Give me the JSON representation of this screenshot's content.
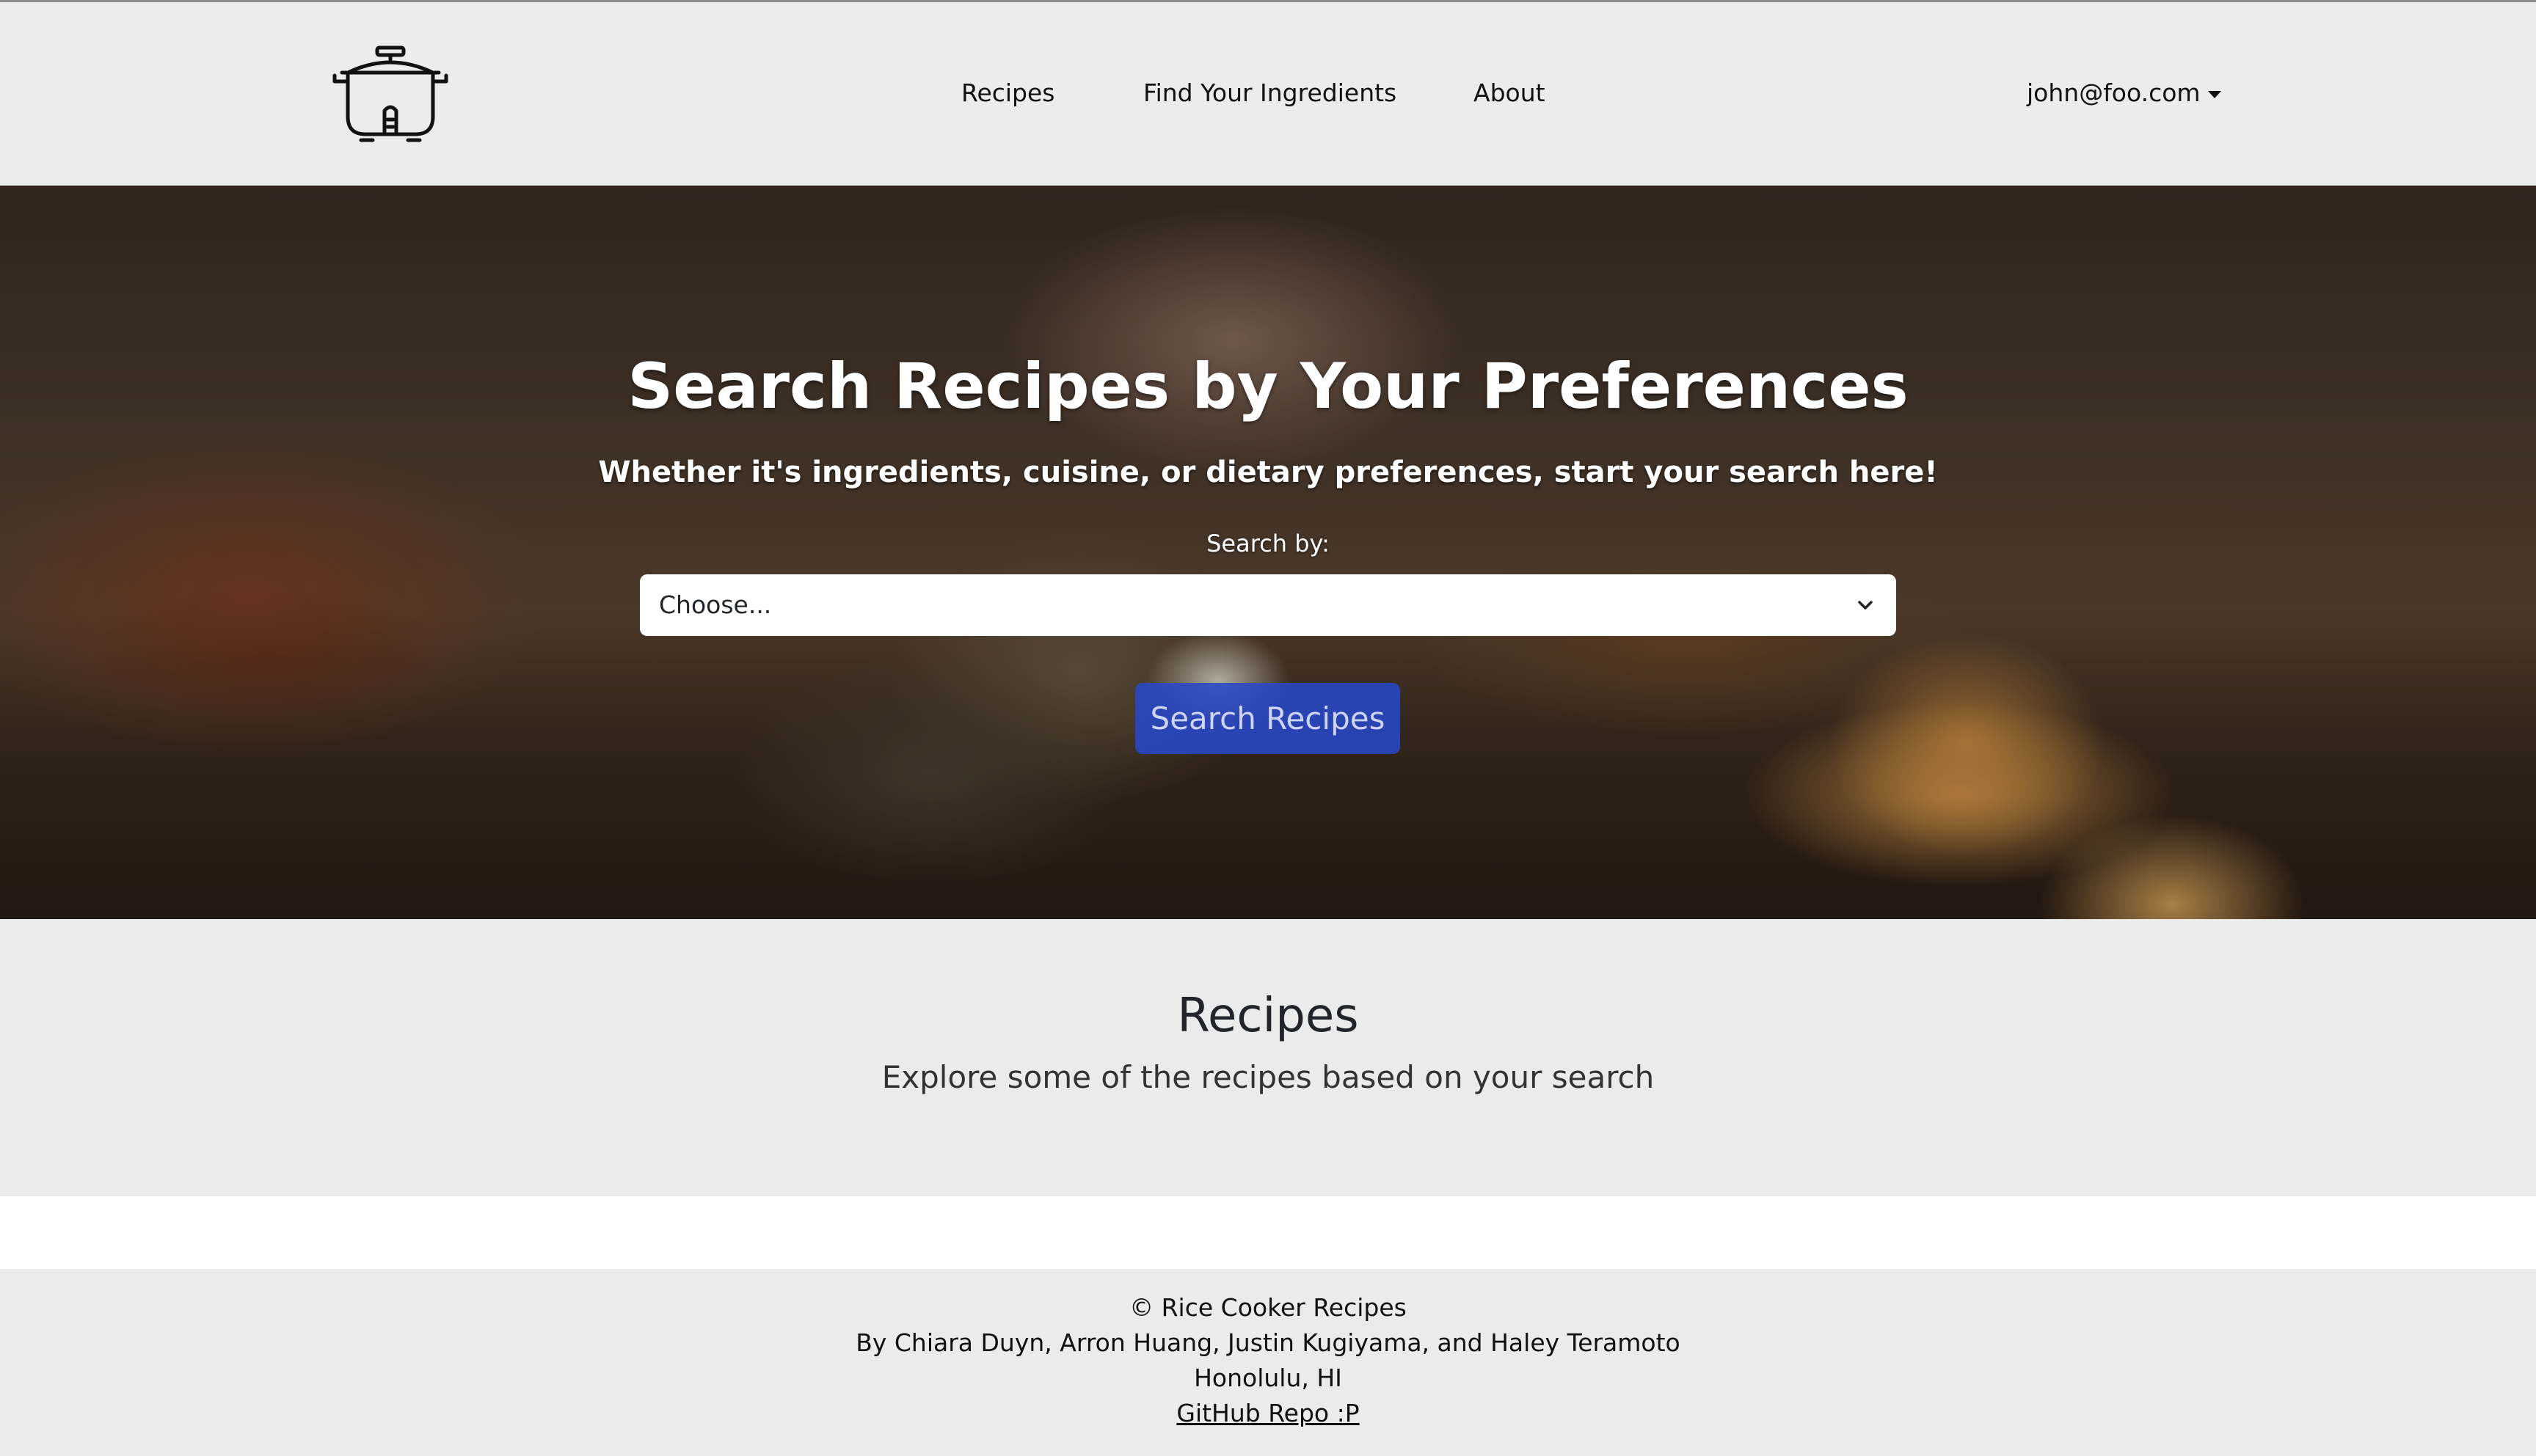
{
  "navbar": {
    "logo_icon": "rice-cooker-icon",
    "links": [
      {
        "label": "Recipes"
      },
      {
        "label": "Find Your Ingredients"
      },
      {
        "label": "About"
      }
    ],
    "user_email": "john@foo.com",
    "user_menu_icon": "caret-down-icon"
  },
  "hero": {
    "title": "Search Recipes by Your Preferences",
    "subtitle": "Whether it's ingredients, cuisine, or dietary preferences, start your search here!",
    "search_label": "Search by:",
    "select_value": "Choose...",
    "select_icon": "chevron-down-icon",
    "search_button_label": "Search Recipes"
  },
  "recipes": {
    "title": "Recipes",
    "subtitle": "Explore some of the recipes based on your search"
  },
  "footer": {
    "copyright": "© Rice Cooker Recipes",
    "authors": "By Chiara Duyn, Arron Huang, Justin Kugiyama, and Haley Teramoto",
    "location": "Honolulu, HI",
    "repo_link": "GitHub Repo :P"
  },
  "colors": {
    "navbar_bg": "#ececec",
    "button_bg": "#2848c8",
    "section_bg": "#ebebeb"
  }
}
